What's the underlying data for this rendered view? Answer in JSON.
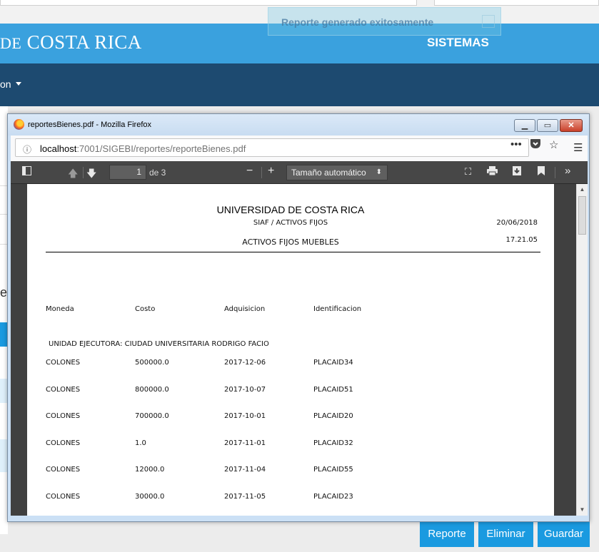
{
  "app": {
    "brand_prefix": "DE",
    "brand_main": "COSTA RICA",
    "section": "SISTEMAS",
    "nav_item": "on",
    "toast": "Reporte generado exitosamente",
    "left_char": "e"
  },
  "buttons": {
    "reporte": "Reporte",
    "eliminar": "Eliminar",
    "guardar": "Guardar"
  },
  "firefox": {
    "window_title": "reportesBienes.pdf - Mozilla Firefox",
    "url_host": "localhost",
    "url_rest": ":7001/SIGEBI/reportes/reporteBienes.pdf",
    "page_number": "1",
    "page_of": "de 3",
    "zoom": "Tamaño automático"
  },
  "report": {
    "title": "UNIVERSIDAD DE COSTA RICA",
    "subtitle": "SIAF / ACTIVOS FIJOS",
    "date": "20/06/2018",
    "heading": "ACTIVOS FIJOS MUEBLES",
    "time": "17.21.05",
    "columns": [
      "Moneda",
      "Costo",
      "Adquisicion",
      "Identificacion"
    ],
    "unit": "UNIDAD EJECUTORA: CIUDAD UNIVERSITARIA RODRIGO FACIO",
    "rows": [
      [
        "COLONES",
        "500000.0",
        "2017-12-06",
        "PLACAID34"
      ],
      [
        "COLONES",
        "800000.0",
        "2017-10-07",
        "PLACAID51"
      ],
      [
        "COLONES",
        "700000.0",
        "2017-10-01",
        "PLACAID20"
      ],
      [
        "COLONES",
        "1.0",
        "2017-11-01",
        "PLACAID32"
      ],
      [
        "COLONES",
        "12000.0",
        "2017-11-04",
        "PLACAID55"
      ],
      [
        "COLONES",
        "30000.0",
        "2017-11-05",
        "PLACAID23"
      ]
    ]
  },
  "colors": {
    "header_blue": "#3aa1de",
    "nav_dark": "#1d4a70",
    "button_blue": "#1a9ae0",
    "pdf_toolbar": "#474747"
  }
}
